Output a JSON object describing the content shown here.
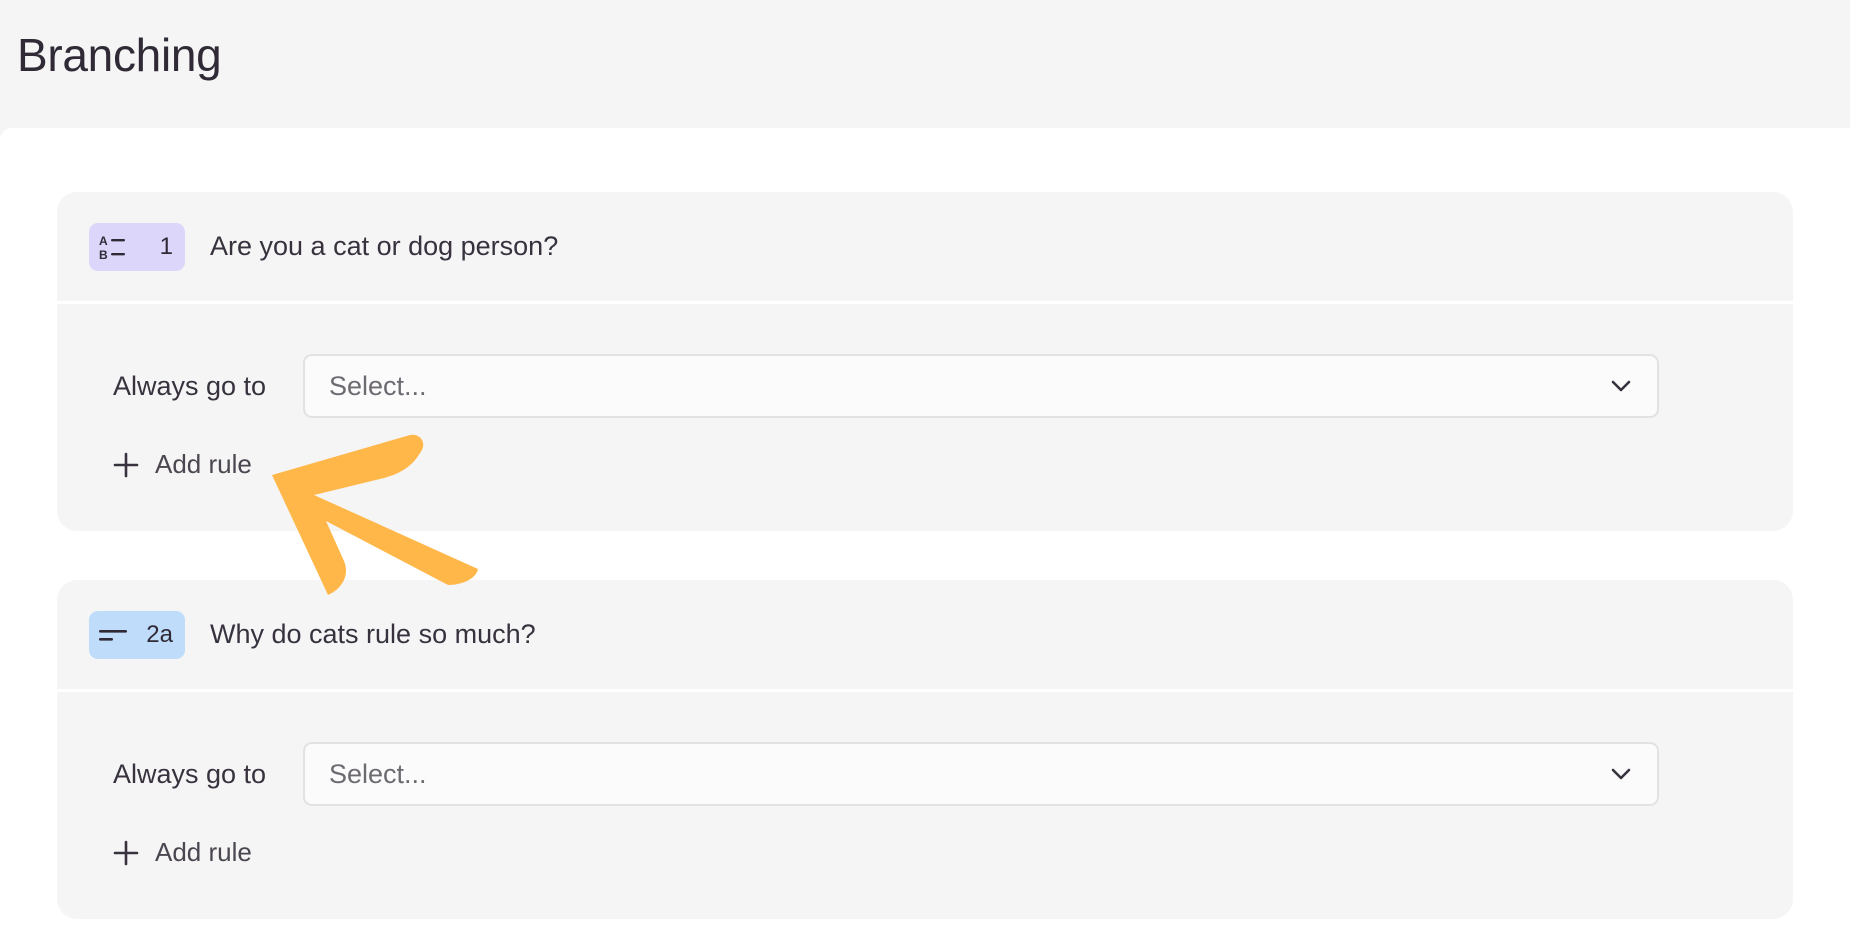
{
  "page": {
    "title": "Branching"
  },
  "questions": [
    {
      "badge_icon": "multiple-choice-icon",
      "number": "1",
      "title": "Are you a cat or dog person?",
      "rule_label": "Always go to",
      "select_placeholder": "Select...",
      "add_rule_label": "Add rule"
    },
    {
      "badge_icon": "short-text-icon",
      "number": "2a",
      "title": "Why do cats rule so much?",
      "rule_label": "Always go to",
      "select_placeholder": "Select...",
      "add_rule_label": "Add rule"
    }
  ],
  "colors": {
    "badge_purple": "#dcd6fb",
    "badge_blue": "#bfdcfb",
    "arrow": "#ffb74a"
  },
  "annotation": {
    "icon": "pointer-arrow-icon"
  }
}
